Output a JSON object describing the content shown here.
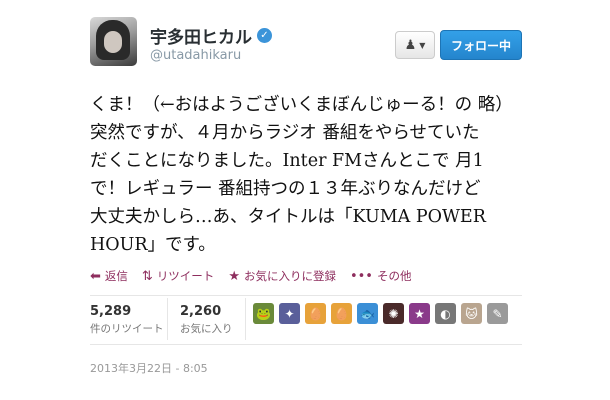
{
  "profile": {
    "display_name": "宇多田ヒカル",
    "handle": "@utadahikaru",
    "verified_glyph": "✓"
  },
  "header": {
    "follow_menu_icon": "person-icon",
    "following_label": "フォロー中"
  },
  "tweet": {
    "lines": [
      "くま！（←おはようございくまぼんじゅーる！の 略）",
      "突然ですが、４月からラジオ 番組をやらせていた",
      "だくことになりました。Inter FMさんとこで 月1",
      "で！レギュラー 番組持つの１３年ぶりなんだけど",
      "大丈夫かしら…あ、タイトルは「KUMA POWER",
      "HOUR」です。"
    ]
  },
  "actions": {
    "reply": "返信",
    "retweet": "リツイート",
    "favorite": "お気に入りに登録",
    "more": "その他"
  },
  "stats": {
    "retweets_count": "5,289",
    "retweets_label": "件のリツイート",
    "favorites_count": "2,260",
    "favorites_label": "お気に入り"
  },
  "favoriters": [
    {
      "icon": "frog-avatar",
      "color": "#6a8a3a",
      "glyph": "🐸"
    },
    {
      "icon": "anime-avatar",
      "color": "#5a5f9a",
      "glyph": "✦"
    },
    {
      "icon": "egg-avatar",
      "color": "#e7a23a",
      "glyph": "🥚"
    },
    {
      "icon": "egg-avatar",
      "color": "#e7a23a",
      "glyph": "🥚"
    },
    {
      "icon": "fish-avatar",
      "color": "#3b8fd6",
      "glyph": "🐟"
    },
    {
      "icon": "dark-avatar",
      "color": "#4a2a2a",
      "glyph": "✺"
    },
    {
      "icon": "character-avatar",
      "color": "#8a3a8a",
      "glyph": "★"
    },
    {
      "icon": "photo-avatar",
      "color": "#777777",
      "glyph": "◐"
    },
    {
      "icon": "cat-avatar",
      "color": "#b9a58f",
      "glyph": "🐱"
    },
    {
      "icon": "sketch-avatar",
      "color": "#9a9a9a",
      "glyph": "✎"
    }
  ],
  "timestamp": "2013年3月22日 - 8:05"
}
